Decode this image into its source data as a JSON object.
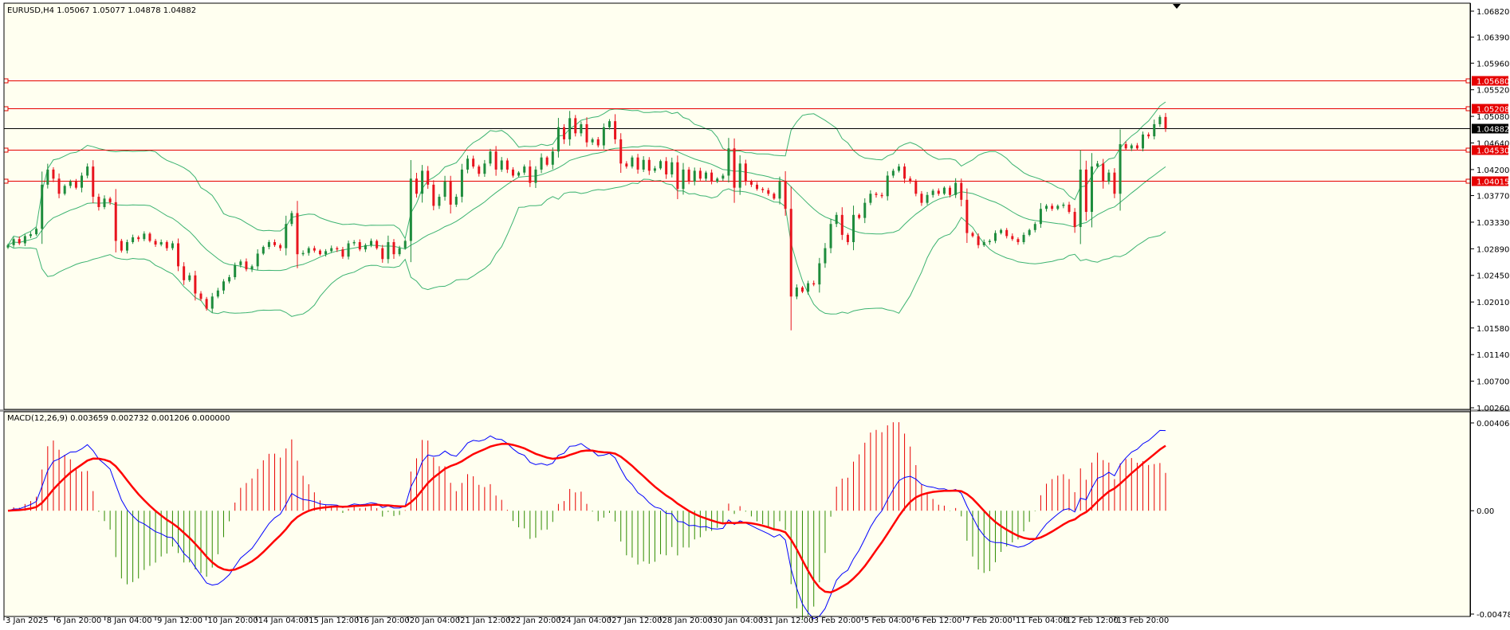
{
  "symbol_info": "EURUSD,H4  1.05067 1.05077 1.04878 1.04882",
  "macd_info": "MACD(12,26,9) 0.003659 0.002732 0.001206 0.000000",
  "colors": {
    "background": "#fffff0",
    "bull_candle": "#1e8c3c",
    "bear_candle": "#e8141e",
    "bands": "#3cb371",
    "hline": "#e60000",
    "macd_line": "#0000ff",
    "signal_line": "#ff0000",
    "hist_pos": "#e80000",
    "hist_neg": "#2e8b00"
  },
  "price_axis": {
    "min": 1.0026,
    "max": 1.0682,
    "ticks": [
      "1.06820",
      "1.06390",
      "1.05960",
      "1.05520",
      "1.05080",
      "1.04640",
      "1.04200",
      "1.03770",
      "1.03330",
      "1.02890",
      "1.02450",
      "1.02010",
      "1.01580",
      "1.01140",
      "1.00700",
      "1.00260"
    ]
  },
  "macd_axis": {
    "min": -0.00478,
    "max": 0.004061,
    "ticks": [
      "0.004061",
      "0.00",
      "-0.00478"
    ]
  },
  "horizontal_lines": [
    {
      "price": 1.0568,
      "label": "1.05680"
    },
    {
      "price": 1.05208,
      "label": "1.05208"
    },
    {
      "price": 1.0453,
      "label": "1.04530"
    },
    {
      "price": 1.04015,
      "label": "1.04015"
    }
  ],
  "current_price": {
    "price": 1.04882,
    "label": "1.04882"
  },
  "time_labels": [
    "3 Jan 2025",
    "6 Jan 20:00",
    "8 Jan 04:00",
    "9 Jan 12:00",
    "10 Jan 20:00",
    "14 Jan 04:00",
    "15 Jan 12:00",
    "16 Jan 20:00",
    "20 Jan 04:00",
    "21 Jan 12:00",
    "22 Jan 20:00",
    "24 Jan 04:00",
    "27 Jan 12:00",
    "28 Jan 20:00",
    "30 Jan 04:00",
    "31 Jan 12:00",
    "3 Feb 20:00",
    "5 Feb 04:00",
    "6 Feb 12:00",
    "7 Feb 20:00",
    "11 Feb 04:00",
    "12 Feb 12:00",
    "13 Feb 20:00"
  ],
  "close_series": [
    1.0295,
    1.0305,
    1.0298,
    1.031,
    1.0313,
    1.0322,
    1.0395,
    1.042,
    1.0405,
    1.038,
    1.0393,
    1.04,
    1.039,
    1.041,
    1.0425,
    1.0375,
    1.0358,
    1.0372,
    1.0366,
    1.0302,
    1.0286,
    1.03,
    1.0308,
    1.0305,
    1.0314,
    1.0302,
    1.0296,
    1.03,
    1.029,
    1.0298,
    1.026,
    1.0237,
    1.0245,
    1.0215,
    1.0206,
    1.019,
    1.021,
    1.022,
    1.0235,
    1.0242,
    1.0262,
    1.0268,
    1.0255,
    1.026,
    1.0281,
    1.0292,
    1.03,
    1.0295,
    1.029,
    1.033,
    1.0348,
    1.028,
    1.0282,
    1.029,
    1.0286,
    1.028,
    1.0285,
    1.029,
    1.0288,
    1.0276,
    1.0298,
    1.03,
    1.0288,
    1.0295,
    1.0302,
    1.029,
    1.0272,
    1.03,
    1.028,
    1.029,
    1.0302,
    1.0405,
    1.038,
    1.0418,
    1.0395,
    1.036,
    1.0375,
    1.04,
    1.0362,
    1.0375,
    1.042,
    1.0438,
    1.0425,
    1.0413,
    1.043,
    1.045,
    1.042,
    1.0435,
    1.042,
    1.041,
    1.0415,
    1.0425,
    1.0398,
    1.042,
    1.044,
    1.0428,
    1.045,
    1.049,
    1.047,
    1.0505,
    1.048,
    1.0495,
    1.0465,
    1.047,
    1.046,
    1.049,
    1.05,
    1.047,
    1.043,
    1.0425,
    1.044,
    1.042,
    1.0436,
    1.0418,
    1.0422,
    1.0434,
    1.0412,
    1.0432,
    1.0388,
    1.042,
    1.04,
    1.0418,
    1.0405,
    1.0415,
    1.04,
    1.0405,
    1.041,
    1.0455,
    1.039,
    1.043,
    1.04,
    1.0395,
    1.0388,
    1.0386,
    1.038,
    1.0372,
    1.04,
    1.0355,
    1.021,
    1.0225,
    1.0218,
    1.0232,
    1.023,
    1.0265,
    1.029,
    1.033,
    1.0345,
    1.0312,
    1.03,
    1.0345,
    1.034,
    1.0365,
    1.038,
    1.0378,
    1.0376,
    1.041,
    1.0418,
    1.0425,
    1.0405,
    1.04,
    1.038,
    1.0365,
    1.0378,
    1.0385,
    1.038,
    1.039,
    1.0378,
    1.0398,
    1.037,
    1.0315,
    1.031,
    1.0295,
    1.03,
    1.0302,
    1.0315,
    1.032,
    1.031,
    1.0305,
    1.03,
    1.0312,
    1.032,
    1.033,
    1.0355,
    1.036,
    1.0355,
    1.036,
    1.0362,
    1.035,
    1.0325,
    1.042,
    1.035,
    1.0425,
    1.043,
    1.04,
    1.0415,
    1.038,
    1.0462,
    1.0455,
    1.046,
    1.0455,
    1.0478,
    1.0475,
    1.0495,
    1.0507,
    1.0488
  ]
}
